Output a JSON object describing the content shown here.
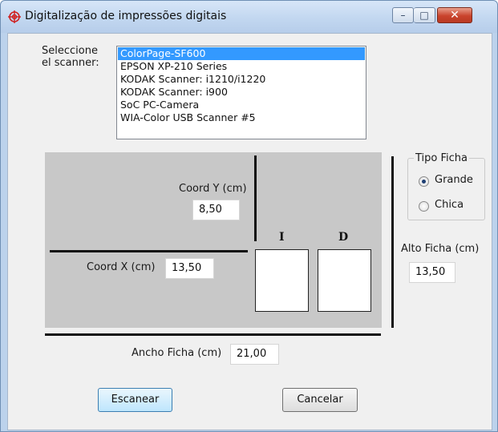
{
  "window": {
    "title": "Digitalização de impressões digitais",
    "controls": {
      "minimize": "–",
      "maximize": "□",
      "close": "✕"
    }
  },
  "scanner": {
    "label": "Seleccione el scanner:",
    "options": [
      "ColorPage-SF600",
      "EPSON XP-210 Series",
      "KODAK Scanner: i1210/i1220",
      "KODAK Scanner: i900",
      "SoC PC-Camera",
      "WIA-Color USB Scanner #5"
    ],
    "selected_index": 0
  },
  "coords": {
    "y_label": "Coord Y (cm)",
    "y_value": "8,50",
    "x_label": "Coord X (cm)",
    "x_value": "13,50"
  },
  "fingers": {
    "left_letter": "I",
    "right_letter": "D"
  },
  "tipo_ficha": {
    "title": "Tipo Ficha",
    "options": [
      "Grande",
      "Chica"
    ],
    "selected": "Grande"
  },
  "alto": {
    "label": "Alto Ficha (cm)",
    "value": "13,50"
  },
  "ancho": {
    "label": "Ancho Ficha (cm)",
    "value": "21,00"
  },
  "buttons": {
    "scan": "Escanear",
    "cancel": "Cancelar"
  },
  "colors": {
    "selection": "#3399ff",
    "panel": "#c8c8c8",
    "close_button": "#c9432c"
  }
}
